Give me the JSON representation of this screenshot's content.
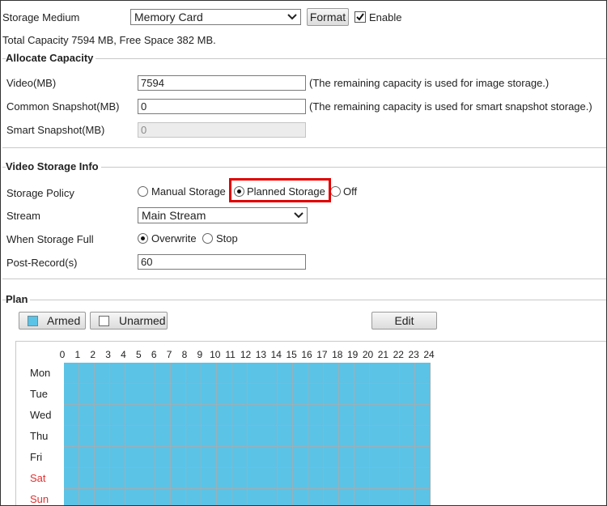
{
  "storage": {
    "medium_label": "Storage Medium",
    "medium_value": "Memory Card",
    "format_button": "Format",
    "enable_label": "Enable",
    "enable_checked": true,
    "capacity_text": "Total Capacity 7594 MB, Free Space 382 MB."
  },
  "allocate": {
    "title": "Allocate Capacity",
    "video_label": "Video(MB)",
    "video_value": "7594",
    "video_note": "(The remaining capacity is used for image storage.)",
    "common_label": "Common Snapshot(MB)",
    "common_value": "0",
    "common_note": "(The remaining capacity is used for smart snapshot storage.)",
    "smart_label": "Smart Snapshot(MB)",
    "smart_value": "0"
  },
  "video_info": {
    "title": "Video Storage Info",
    "policy_label": "Storage Policy",
    "policy_options": [
      "Manual Storage",
      "Planned Storage",
      "Off"
    ],
    "policy_selected": "Planned Storage",
    "stream_label": "Stream",
    "stream_value": "Main Stream",
    "full_label": "When Storage Full",
    "full_options": [
      "Overwrite",
      "Stop"
    ],
    "full_selected": "Overwrite",
    "post_label": "Post-Record(s)",
    "post_value": "60"
  },
  "plan": {
    "title": "Plan",
    "armed_button": "Armed",
    "unarmed_button": "Unarmed",
    "edit_button": "Edit",
    "armed_color": "#5bc3e6",
    "hours": [
      "0",
      "1",
      "2",
      "3",
      "4",
      "5",
      "6",
      "7",
      "8",
      "9",
      "10",
      "11",
      "12",
      "13",
      "14",
      "15",
      "16",
      "17",
      "18",
      "19",
      "20",
      "21",
      "22",
      "23",
      "24"
    ],
    "days": [
      "Mon",
      "Tue",
      "Wed",
      "Thu",
      "Fri",
      "Sat",
      "Sun"
    ],
    "weekend_color": "#e03030",
    "all_armed": true
  }
}
